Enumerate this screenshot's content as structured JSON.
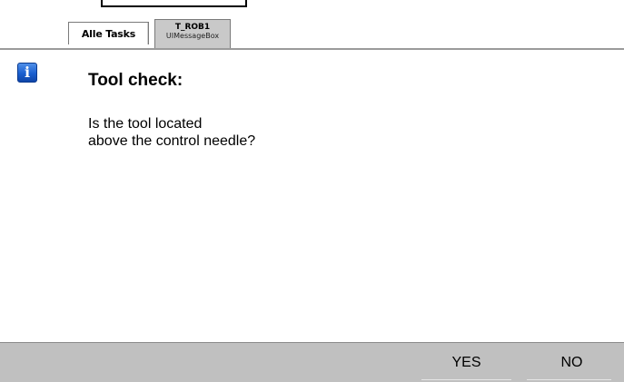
{
  "tabs": [
    {
      "label": "Alle Tasks",
      "active": false
    },
    {
      "label": "T_ROB1",
      "sublabel": "UIMessageBox",
      "active": true
    }
  ],
  "message_box": {
    "icon": "info-icon",
    "title": "Tool check:",
    "lines": [
      "Is the tool located",
      "above the control needle?"
    ]
  },
  "buttons": {
    "yes_label": "YES",
    "no_label": "NO"
  },
  "colors": {
    "icon_blue": "#1a5fd0",
    "button_bar": "#c0c0c0",
    "active_tab": "#c9c9c9"
  }
}
